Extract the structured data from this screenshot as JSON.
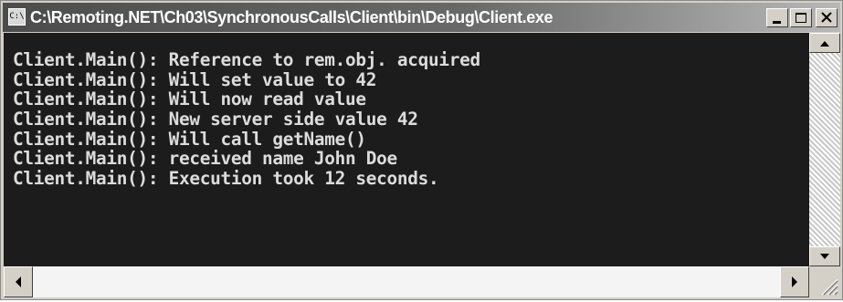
{
  "window": {
    "title": "C:\\Remoting.NET\\Ch03\\SynchronousCalls\\Client\\bin\\Debug\\Client.exe",
    "system_icon_text": "C:\\"
  },
  "console": {
    "lines": [
      "Client.Main(): Reference to rem.obj. acquired",
      "Client.Main(): Will set value to 42",
      "Client.Main(): Will now read value",
      "Client.Main(): New server side value 42",
      "Client.Main(): Will call getName()",
      "Client.Main(): received name John Doe",
      "Client.Main(): Execution took 12 seconds."
    ]
  },
  "icons": {
    "minimize": "minimize-icon",
    "maximize": "maximize-icon",
    "close": "close-icon",
    "scroll_up": "arrow-up-icon",
    "scroll_down": "arrow-down-icon",
    "scroll_left": "arrow-left-icon",
    "scroll_right": "arrow-right-icon",
    "resize_grip": "resize-grip-icon"
  },
  "colors": {
    "console_background": "#1c1c1c",
    "console_text": "#dcdcdc"
  }
}
